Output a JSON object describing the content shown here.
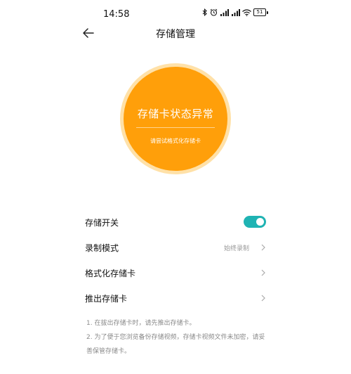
{
  "status_bar": {
    "time": "14:58",
    "battery": "51"
  },
  "header": {
    "title": "存储管理"
  },
  "status_circle": {
    "title": "存储卡状态异常",
    "subtitle": "请尝试格式化存储卡",
    "color": "#ff9f0a"
  },
  "settings": {
    "storage_switch": {
      "label": "存储开关",
      "enabled": true
    },
    "record_mode": {
      "label": "录制模式",
      "value": "始终录制"
    },
    "format_card": {
      "label": "格式化存储卡"
    },
    "eject_card": {
      "label": "推出存储卡"
    }
  },
  "notes": [
    "1. 在拔出存储卡时，请先推出存储卡。",
    "2. 为了便于您浏览备份存储视频，存储卡视频文件未加密，请妥善保管存储卡。"
  ],
  "colors": {
    "accent": "#1fb3b3"
  }
}
